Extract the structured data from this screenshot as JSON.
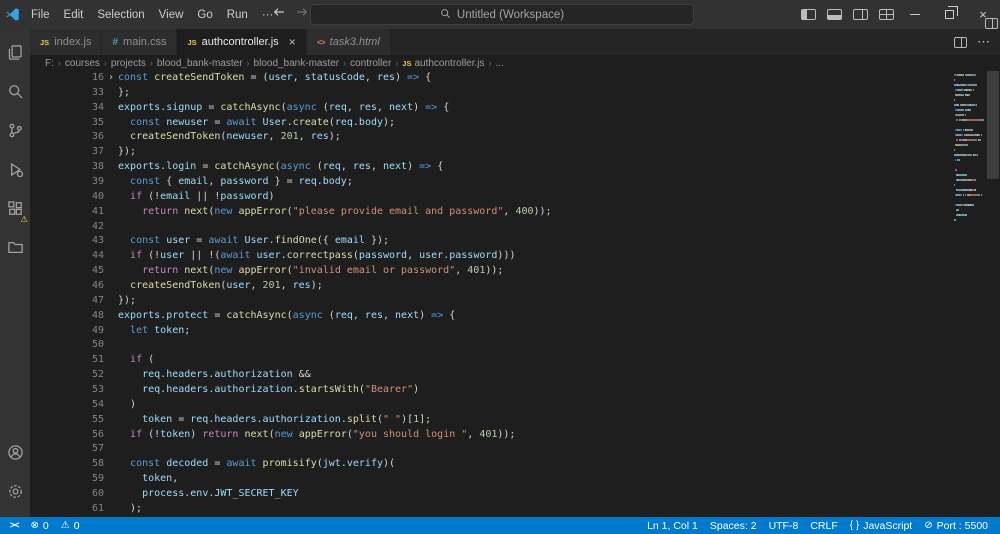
{
  "titlebar": {
    "menus": [
      "File",
      "Edit",
      "Selection",
      "View",
      "Go",
      "Run",
      "···"
    ],
    "command_center": "Untitled (Workspace)"
  },
  "icons": {
    "file": {
      "js": "JS",
      "css": "#",
      "html": "<>"
    },
    "close": "×",
    "more": "⋯",
    "window_close": "×",
    "fold_collapsed": "›",
    "status": {
      "remote": "><",
      "error": "⊗",
      "warning": "⚠",
      "braces": "{ }",
      "port": "⊘"
    }
  },
  "tabs": {
    "items": [
      {
        "label": "index.js",
        "icon": "js",
        "active": false,
        "preview": false
      },
      {
        "label": "main.css",
        "icon": "css",
        "active": false,
        "preview": false
      },
      {
        "label": "authcontroller.js",
        "icon": "js",
        "active": true,
        "preview": false
      },
      {
        "label": "task3.html",
        "icon": "html",
        "active": false,
        "preview": true
      }
    ]
  },
  "breadcrumbs": [
    {
      "label": "F:"
    },
    {
      "label": "courses"
    },
    {
      "label": "projects"
    },
    {
      "label": "blood_bank-master"
    },
    {
      "label": "blood_bank-master"
    },
    {
      "label": "controller"
    },
    {
      "label": "authcontroller.js",
      "icon": "js"
    },
    {
      "label": "..."
    }
  ],
  "activitybar": {
    "top": [
      {
        "name": "explorer"
      },
      {
        "name": "search"
      },
      {
        "name": "source-control"
      },
      {
        "name": "run-debug"
      },
      {
        "name": "extensions",
        "badge": "⚠"
      },
      {
        "name": "folders"
      }
    ],
    "bottom": [
      {
        "name": "account"
      },
      {
        "name": "settings"
      }
    ]
  },
  "colors": {
    "b": "#569cd6",
    "p": "#c586c0",
    "v": "#9cdcfe",
    "f": "#dcdcaa",
    "s": "#ce9178",
    "n": "#b5cea8",
    "w": "#d4d4d4",
    "accent": "#007acc"
  },
  "editor": {
    "lines": [
      {
        "n": 16,
        "fold": true,
        "t": [
          [
            "b",
            "const "
          ],
          [
            "f",
            "createSendToken"
          ],
          [
            "w",
            " = ("
          ],
          [
            "v",
            "user"
          ],
          [
            "w",
            ", "
          ],
          [
            "v",
            "statusCode"
          ],
          [
            "w",
            ", "
          ],
          [
            "v",
            "res"
          ],
          [
            "w",
            ") "
          ],
          [
            "b",
            "=>"
          ],
          [
            "w",
            " {"
          ]
        ]
      },
      {
        "n": 33,
        "t": [
          [
            "w",
            "};"
          ]
        ]
      },
      {
        "n": 34,
        "t": [
          [
            "v",
            "exports"
          ],
          [
            "w",
            "."
          ],
          [
            "v",
            "signup"
          ],
          [
            "w",
            " = "
          ],
          [
            "f",
            "catchAsync"
          ],
          [
            "w",
            "("
          ],
          [
            "b",
            "async"
          ],
          [
            "w",
            " ("
          ],
          [
            "v",
            "req"
          ],
          [
            "w",
            ", "
          ],
          [
            "v",
            "res"
          ],
          [
            "w",
            ", "
          ],
          [
            "v",
            "next"
          ],
          [
            "w",
            ") "
          ],
          [
            "b",
            "=>"
          ],
          [
            "w",
            " {"
          ]
        ]
      },
      {
        "n": 35,
        "t": [
          [
            "w",
            "  "
          ],
          [
            "b",
            "const"
          ],
          [
            "w",
            " "
          ],
          [
            "v",
            "newuser"
          ],
          [
            "w",
            " = "
          ],
          [
            "b",
            "await"
          ],
          [
            "w",
            " "
          ],
          [
            "v",
            "User"
          ],
          [
            "w",
            "."
          ],
          [
            "f",
            "create"
          ],
          [
            "w",
            "("
          ],
          [
            "v",
            "req"
          ],
          [
            "w",
            "."
          ],
          [
            "v",
            "body"
          ],
          [
            "w",
            ");"
          ]
        ]
      },
      {
        "n": 36,
        "t": [
          [
            "w",
            "  "
          ],
          [
            "f",
            "createSendToken"
          ],
          [
            "w",
            "("
          ],
          [
            "v",
            "newuser"
          ],
          [
            "w",
            ", "
          ],
          [
            "n",
            "201"
          ],
          [
            "w",
            ", "
          ],
          [
            "v",
            "res"
          ],
          [
            "w",
            ");"
          ]
        ]
      },
      {
        "n": 37,
        "t": [
          [
            "w",
            "});"
          ]
        ]
      },
      {
        "n": 38,
        "t": [
          [
            "v",
            "exports"
          ],
          [
            "w",
            "."
          ],
          [
            "v",
            "login"
          ],
          [
            "w",
            " = "
          ],
          [
            "f",
            "catchAsync"
          ],
          [
            "w",
            "("
          ],
          [
            "b",
            "async"
          ],
          [
            "w",
            " ("
          ],
          [
            "v",
            "req"
          ],
          [
            "w",
            ", "
          ],
          [
            "v",
            "res"
          ],
          [
            "w",
            ", "
          ],
          [
            "v",
            "next"
          ],
          [
            "w",
            ") "
          ],
          [
            "b",
            "=>"
          ],
          [
            "w",
            " {"
          ]
        ]
      },
      {
        "n": 39,
        "t": [
          [
            "w",
            "  "
          ],
          [
            "b",
            "const"
          ],
          [
            "w",
            " { "
          ],
          [
            "v",
            "email"
          ],
          [
            "w",
            ", "
          ],
          [
            "v",
            "password"
          ],
          [
            "w",
            " } = "
          ],
          [
            "v",
            "req"
          ],
          [
            "w",
            "."
          ],
          [
            "v",
            "body"
          ],
          [
            "w",
            ";"
          ]
        ]
      },
      {
        "n": 40,
        "t": [
          [
            "w",
            "  "
          ],
          [
            "p",
            "if"
          ],
          [
            "w",
            " (!"
          ],
          [
            "v",
            "email"
          ],
          [
            "w",
            " || !"
          ],
          [
            "v",
            "password"
          ],
          [
            "w",
            ")"
          ]
        ]
      },
      {
        "n": 41,
        "t": [
          [
            "w",
            "    "
          ],
          [
            "p",
            "return"
          ],
          [
            "w",
            " "
          ],
          [
            "f",
            "next"
          ],
          [
            "w",
            "("
          ],
          [
            "b",
            "new"
          ],
          [
            "w",
            " "
          ],
          [
            "f",
            "appError"
          ],
          [
            "w",
            "("
          ],
          [
            "s",
            "\"please provide email and password\""
          ],
          [
            "w",
            ", "
          ],
          [
            "n",
            "400"
          ],
          [
            "w",
            "));"
          ]
        ]
      },
      {
        "n": 42,
        "t": []
      },
      {
        "n": 43,
        "t": [
          [
            "w",
            "  "
          ],
          [
            "b",
            "const"
          ],
          [
            "w",
            " "
          ],
          [
            "v",
            "user"
          ],
          [
            "w",
            " = "
          ],
          [
            "b",
            "await"
          ],
          [
            "w",
            " "
          ],
          [
            "v",
            "User"
          ],
          [
            "w",
            "."
          ],
          [
            "f",
            "findOne"
          ],
          [
            "w",
            "({ "
          ],
          [
            "v",
            "email"
          ],
          [
            "w",
            " });"
          ]
        ]
      },
      {
        "n": 44,
        "t": [
          [
            "w",
            "  "
          ],
          [
            "p",
            "if"
          ],
          [
            "w",
            " (!"
          ],
          [
            "v",
            "user"
          ],
          [
            "w",
            " || !("
          ],
          [
            "b",
            "await"
          ],
          [
            "w",
            " "
          ],
          [
            "v",
            "user"
          ],
          [
            "w",
            "."
          ],
          [
            "f",
            "correctpass"
          ],
          [
            "w",
            "("
          ],
          [
            "v",
            "password"
          ],
          [
            "w",
            ", "
          ],
          [
            "v",
            "user"
          ],
          [
            "w",
            "."
          ],
          [
            "v",
            "password"
          ],
          [
            "w",
            ")))"
          ]
        ]
      },
      {
        "n": 45,
        "t": [
          [
            "w",
            "    "
          ],
          [
            "p",
            "return"
          ],
          [
            "w",
            " "
          ],
          [
            "f",
            "next"
          ],
          [
            "w",
            "("
          ],
          [
            "b",
            "new"
          ],
          [
            "w",
            " "
          ],
          [
            "f",
            "appError"
          ],
          [
            "w",
            "("
          ],
          [
            "s",
            "\"invalid email or password\""
          ],
          [
            "w",
            ", "
          ],
          [
            "n",
            "401"
          ],
          [
            "w",
            "));"
          ]
        ]
      },
      {
        "n": 46,
        "t": [
          [
            "w",
            "  "
          ],
          [
            "f",
            "createSendToken"
          ],
          [
            "w",
            "("
          ],
          [
            "v",
            "user"
          ],
          [
            "w",
            ", "
          ],
          [
            "n",
            "201"
          ],
          [
            "w",
            ", "
          ],
          [
            "v",
            "res"
          ],
          [
            "w",
            ");"
          ]
        ]
      },
      {
        "n": 47,
        "t": [
          [
            "w",
            "});"
          ]
        ]
      },
      {
        "n": 48,
        "t": [
          [
            "v",
            "exports"
          ],
          [
            "w",
            "."
          ],
          [
            "v",
            "protect"
          ],
          [
            "w",
            " = "
          ],
          [
            "f",
            "catchAsync"
          ],
          [
            "w",
            "("
          ],
          [
            "b",
            "async"
          ],
          [
            "w",
            " ("
          ],
          [
            "v",
            "req"
          ],
          [
            "w",
            ", "
          ],
          [
            "v",
            "res"
          ],
          [
            "w",
            ", "
          ],
          [
            "v",
            "next"
          ],
          [
            "w",
            ") "
          ],
          [
            "b",
            "=>"
          ],
          [
            "w",
            " {"
          ]
        ]
      },
      {
        "n": 49,
        "t": [
          [
            "w",
            "  "
          ],
          [
            "b",
            "let"
          ],
          [
            "w",
            " "
          ],
          [
            "v",
            "token"
          ],
          [
            "w",
            ";"
          ]
        ]
      },
      {
        "n": 50,
        "t": []
      },
      {
        "n": 51,
        "t": [
          [
            "w",
            "  "
          ],
          [
            "p",
            "if"
          ],
          [
            "w",
            " ("
          ]
        ]
      },
      {
        "n": 52,
        "t": [
          [
            "w",
            "    "
          ],
          [
            "v",
            "req"
          ],
          [
            "w",
            "."
          ],
          [
            "v",
            "headers"
          ],
          [
            "w",
            "."
          ],
          [
            "v",
            "authorization"
          ],
          [
            "w",
            " &&"
          ]
        ]
      },
      {
        "n": 53,
        "t": [
          [
            "w",
            "    "
          ],
          [
            "v",
            "req"
          ],
          [
            "w",
            "."
          ],
          [
            "v",
            "headers"
          ],
          [
            "w",
            "."
          ],
          [
            "v",
            "authorization"
          ],
          [
            "w",
            "."
          ],
          [
            "f",
            "startsWith"
          ],
          [
            "w",
            "("
          ],
          [
            "s",
            "\"Bearer\""
          ],
          [
            "w",
            ")"
          ]
        ]
      },
      {
        "n": 54,
        "t": [
          [
            "w",
            "  )"
          ]
        ]
      },
      {
        "n": 55,
        "t": [
          [
            "w",
            "    "
          ],
          [
            "v",
            "token"
          ],
          [
            "w",
            " = "
          ],
          [
            "v",
            "req"
          ],
          [
            "w",
            "."
          ],
          [
            "v",
            "headers"
          ],
          [
            "w",
            "."
          ],
          [
            "v",
            "authorization"
          ],
          [
            "w",
            "."
          ],
          [
            "f",
            "split"
          ],
          [
            "w",
            "("
          ],
          [
            "s",
            "\" \""
          ],
          [
            "w",
            ")["
          ],
          [
            "n",
            "1"
          ],
          [
            "w",
            "];"
          ]
        ]
      },
      {
        "n": 56,
        "t": [
          [
            "w",
            "  "
          ],
          [
            "p",
            "if"
          ],
          [
            "w",
            " (!"
          ],
          [
            "v",
            "token"
          ],
          [
            "w",
            ") "
          ],
          [
            "p",
            "return"
          ],
          [
            "w",
            " "
          ],
          [
            "f",
            "next"
          ],
          [
            "w",
            "("
          ],
          [
            "b",
            "new"
          ],
          [
            "w",
            " "
          ],
          [
            "f",
            "appError"
          ],
          [
            "w",
            "("
          ],
          [
            "s",
            "\"you should login \""
          ],
          [
            "w",
            ", "
          ],
          [
            "n",
            "401"
          ],
          [
            "w",
            "));"
          ]
        ]
      },
      {
        "n": 57,
        "t": []
      },
      {
        "n": 58,
        "t": [
          [
            "w",
            "  "
          ],
          [
            "b",
            "const"
          ],
          [
            "w",
            " "
          ],
          [
            "v",
            "decoded"
          ],
          [
            "w",
            " = "
          ],
          [
            "b",
            "await"
          ],
          [
            "w",
            " "
          ],
          [
            "f",
            "promisify"
          ],
          [
            "w",
            "("
          ],
          [
            "v",
            "jwt"
          ],
          [
            "w",
            "."
          ],
          [
            "v",
            "verify"
          ],
          [
            "w",
            ")("
          ]
        ]
      },
      {
        "n": 59,
        "t": [
          [
            "w",
            "    "
          ],
          [
            "v",
            "token"
          ],
          [
            "w",
            ","
          ]
        ]
      },
      {
        "n": 60,
        "t": [
          [
            "w",
            "    "
          ],
          [
            "v",
            "process"
          ],
          [
            "w",
            "."
          ],
          [
            "v",
            "env"
          ],
          [
            "w",
            "."
          ],
          [
            "v",
            "JWT_SECRET_KEY"
          ]
        ]
      },
      {
        "n": 61,
        "t": [
          [
            "w",
            "  );"
          ]
        ]
      }
    ]
  },
  "statusbar": {
    "left": [
      {
        "name": "remote",
        "icon": "remote",
        "label": ""
      },
      {
        "name": "errors",
        "icon": "error",
        "label": "0"
      },
      {
        "name": "warnings",
        "icon": "warning",
        "label": "0"
      }
    ],
    "right": [
      {
        "name": "cursor-position",
        "label": "Ln 1, Col 1"
      },
      {
        "name": "indentation",
        "label": "Spaces: 2"
      },
      {
        "name": "encoding",
        "label": "UTF-8"
      },
      {
        "name": "eol",
        "label": "CRLF"
      },
      {
        "name": "language",
        "icon": "braces",
        "label": "JavaScript"
      },
      {
        "name": "live-server-port",
        "icon": "port",
        "label": "Port : 5500"
      }
    ]
  }
}
